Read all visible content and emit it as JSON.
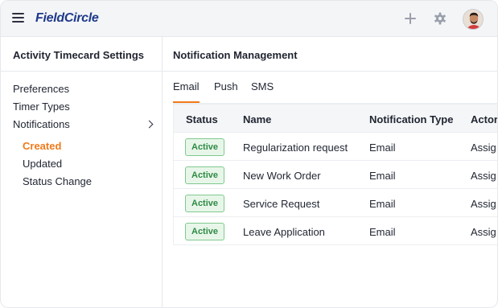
{
  "header": {
    "brand": "FieldCircle",
    "icons": [
      "menu-icon",
      "plus-icon",
      "gear-icon",
      "avatar"
    ]
  },
  "sidebar": {
    "title": "Activity Timecard Settings",
    "items": [
      "Preferences",
      "Timer Types",
      "Notifications"
    ],
    "sub_items": [
      "Created",
      "Updated",
      "Status Change"
    ],
    "active_sub_item": "Created"
  },
  "main": {
    "title": "Notification Management",
    "tabs": [
      "Email",
      "Push",
      "SMS"
    ],
    "active_tab": "Email"
  },
  "table": {
    "columns": [
      "Status",
      "Name",
      "Notification Type",
      "Actor"
    ],
    "rows": [
      {
        "status": "Active",
        "name": "Regularization request",
        "type": "Email",
        "actor": "Assig"
      },
      {
        "status": "Active",
        "name": "New Work Order",
        "type": "Email",
        "actor": "Assig"
      },
      {
        "status": "Active",
        "name": "Service Request",
        "type": "Email",
        "actor": "Assig"
      },
      {
        "status": "Active",
        "name": "Leave Application",
        "type": "Email",
        "actor": "Assig"
      }
    ]
  },
  "colors": {
    "brand": "#1e3a8a",
    "accent": "#f07a1a",
    "active_badge_text": "#2e8a44",
    "active_badge_bg": "#e8f6ea"
  }
}
